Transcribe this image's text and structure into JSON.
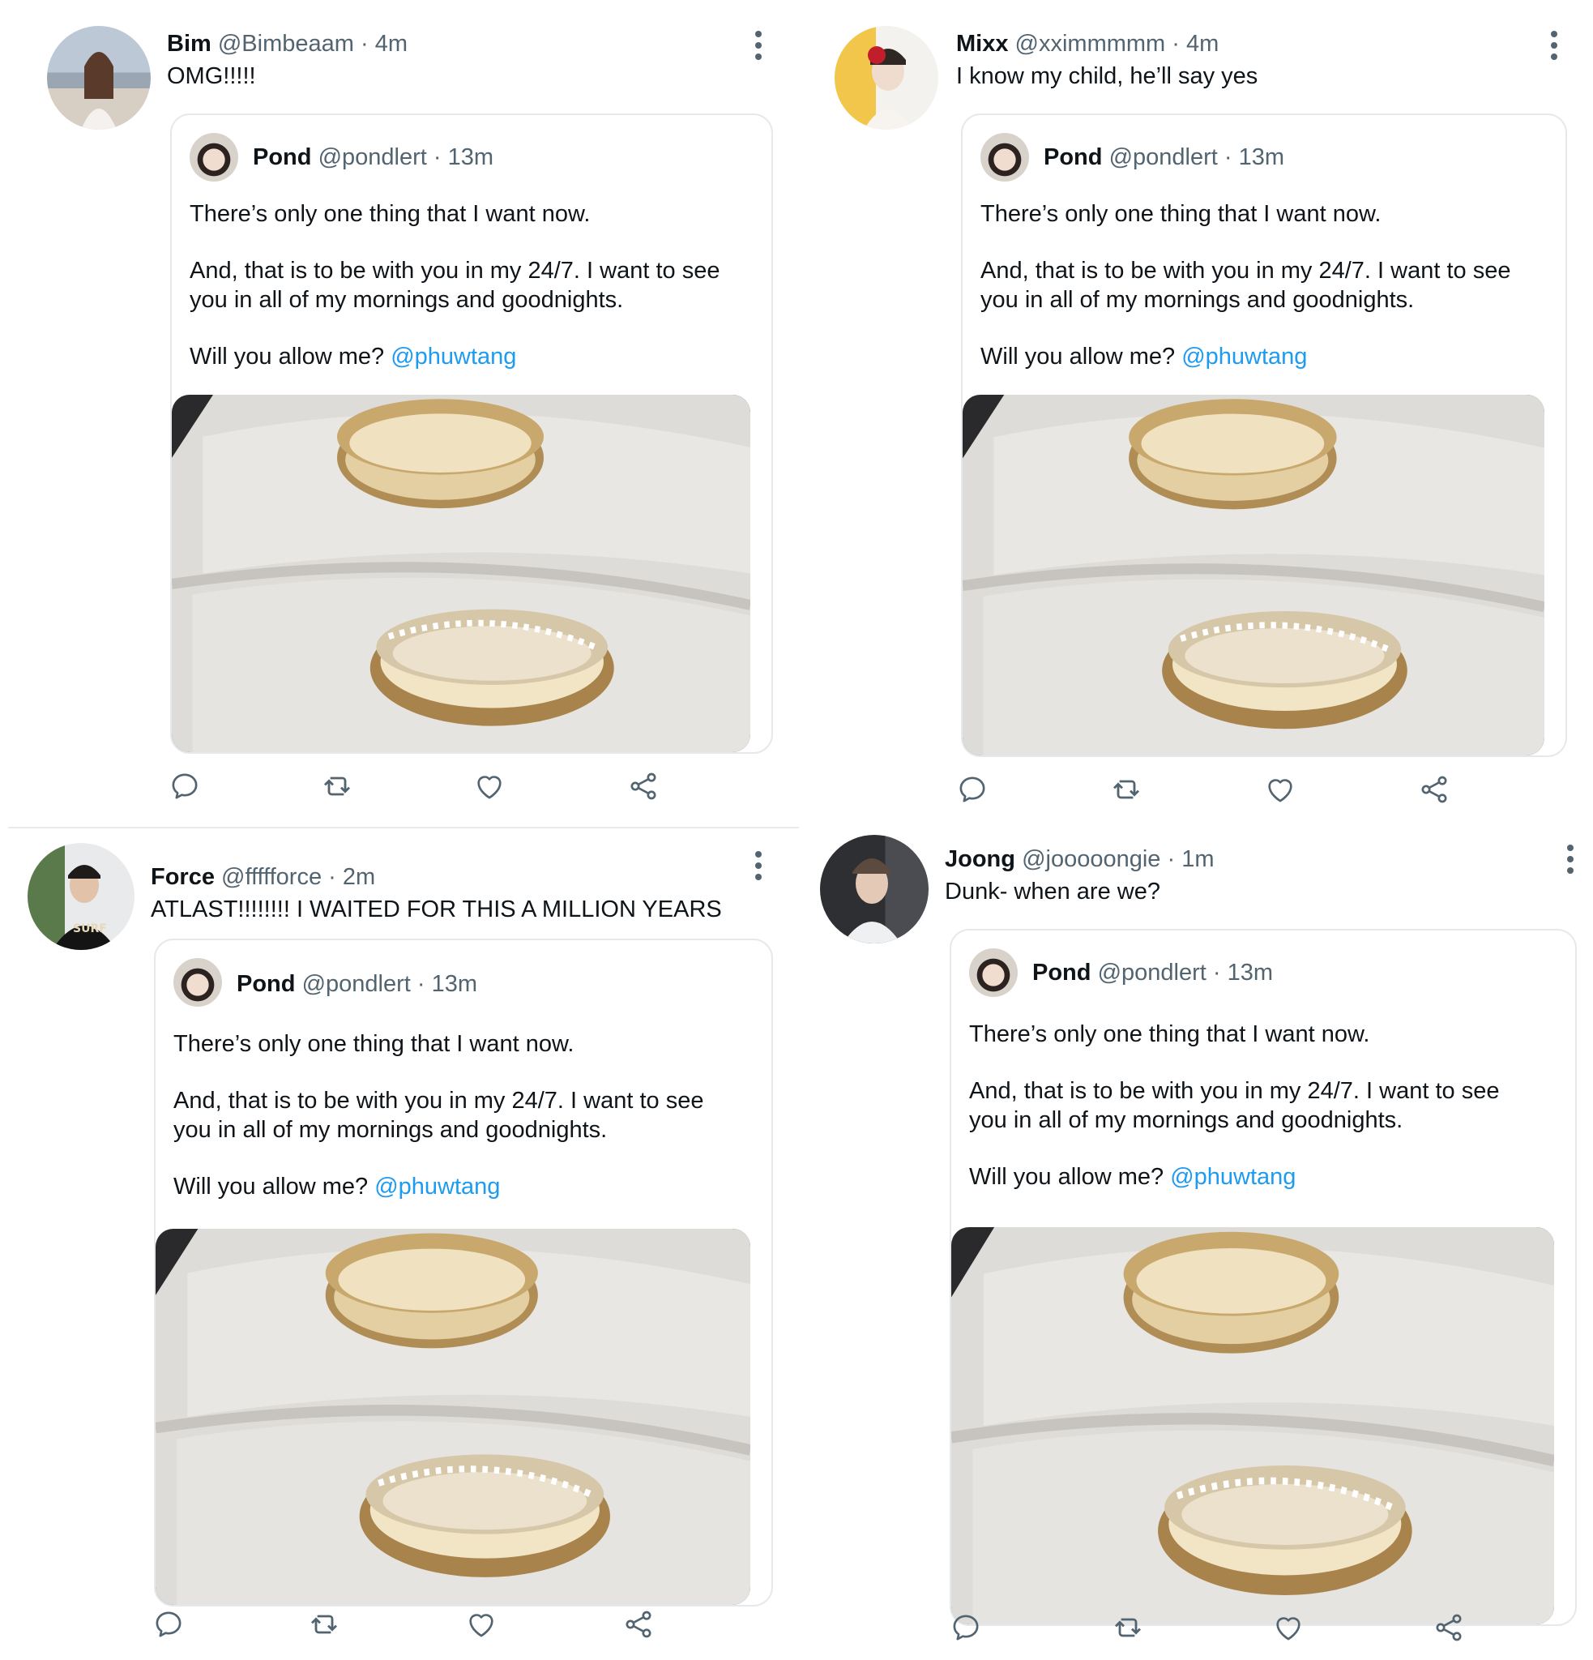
{
  "tweets": [
    {
      "author": {
        "name": "Bim",
        "handle": "@Bimbeaam",
        "time": "4m"
      },
      "text": "OMG!!!!!",
      "quote": {
        "author": {
          "name": "Pond",
          "handle": "@pondlert",
          "time": "13m"
        },
        "line1": "There’s only one thing that I want now.",
        "line2a": "And, that is to be with you in my 24/7. I want to see",
        "line2b": "you in all of my mornings and goodnights.",
        "line3": "Will you allow me?",
        "mention": "@phuwtang"
      }
    },
    {
      "author": {
        "name": "Mixx",
        "handle": "@xximmmmm",
        "time": "4m"
      },
      "text": "I know my child, he’ll say yes",
      "quote": {
        "author": {
          "name": "Pond",
          "handle": "@pondlert",
          "time": "13m"
        },
        "line1": "There’s only one thing that I want now.",
        "line2a": "And, that is to be with you in my 24/7. I want to see",
        "line2b": "you in all of my mornings and goodnights.",
        "line3": "Will you allow me?",
        "mention": "@phuwtang"
      }
    },
    {
      "author": {
        "name": "Force",
        "handle": "@ffffforce",
        "time": "2m"
      },
      "text": "ATLAST!!!!!!!! I WAITED FOR THIS A MILLION YEARS",
      "quote": {
        "author": {
          "name": "Pond",
          "handle": "@pondlert",
          "time": "13m"
        },
        "line1": "There’s only one thing that I want now.",
        "line2a": "And, that is to be with you in my 24/7. I want to see",
        "line2b": "you in all of my mornings and goodnights.",
        "line3": "Will you allow me?",
        "mention": "@phuwtang"
      }
    },
    {
      "author": {
        "name": "Joong",
        "handle": "@jooooongie",
        "time": "1m"
      },
      "text": "Dunk- when are we?",
      "quote": {
        "author": {
          "name": "Pond",
          "handle": "@pondlert",
          "time": "13m"
        },
        "line1": "There’s only one thing that I want now.",
        "line2a": "And, that is to be with you in my 24/7. I want to see",
        "line2b": "you in all of my mornings and goodnights.",
        "line3": "Will you allow me?",
        "mention": "@phuwtang"
      }
    }
  ],
  "separator": "·",
  "icons": [
    "reply-icon",
    "retweet-icon",
    "like-icon",
    "share-icon",
    "more-icon"
  ],
  "colors": {
    "mention": "#1d9bf0",
    "secondary": "#536471",
    "border": "#e6e9ec"
  }
}
